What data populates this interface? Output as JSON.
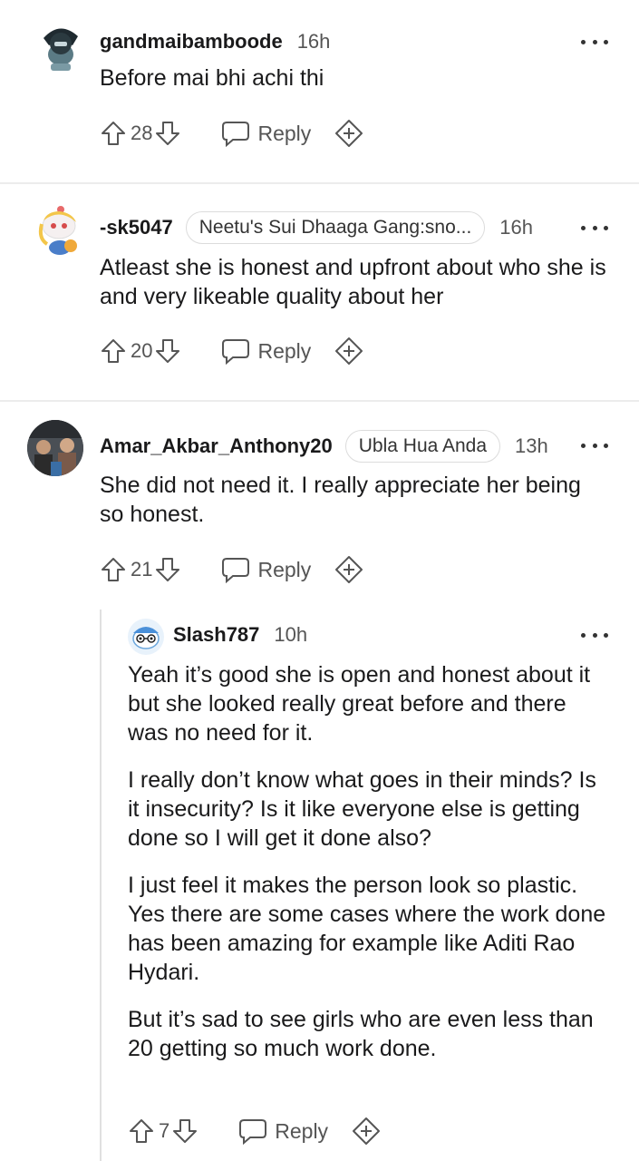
{
  "comments": [
    {
      "username": "gandmaibamboode",
      "flair": "",
      "time": "16h",
      "body": [
        "Before mai bhi achi thi"
      ],
      "upvotes": "28",
      "reply_label": "Reply"
    },
    {
      "username": "-sk5047",
      "flair": "Neetu's Sui Dhaaga Gang:sno...",
      "time": "16h",
      "body": [
        "Atleast she is honest and upfront about who she is and very likeable quality about her"
      ],
      "upvotes": "20",
      "reply_label": "Reply"
    },
    {
      "username": "Amar_Akbar_Anthony20",
      "flair": "Ubla Hua Anda",
      "time": "13h",
      "body": [
        "She did not need it. I really appreciate her being so honest."
      ],
      "upvotes": "21",
      "reply_label": "Reply"
    },
    {
      "username": "Slash787",
      "flair": "",
      "time": "10h",
      "body": [
        "Yeah it’s good she is open and honest about it but she looked really great before and there was no need for it.",
        "I really don’t know what goes in their minds? Is it insecurity? Is it like everyone else is getting done so I will get it done also?",
        "I just feel it makes the person look so plastic. Yes there are some cases where the work done has been amazing for example like Aditi Rao Hydari.",
        "But it’s sad to see girls who are even less than 20 getting so much work done."
      ],
      "upvotes": "7",
      "reply_label": "Reply"
    }
  ],
  "icons": {
    "upvote": "arrow-up-icon",
    "downvote": "arrow-down-icon",
    "reply": "speech-bubble-icon",
    "award": "award-plus-icon",
    "more": "ellipsis-icon"
  }
}
